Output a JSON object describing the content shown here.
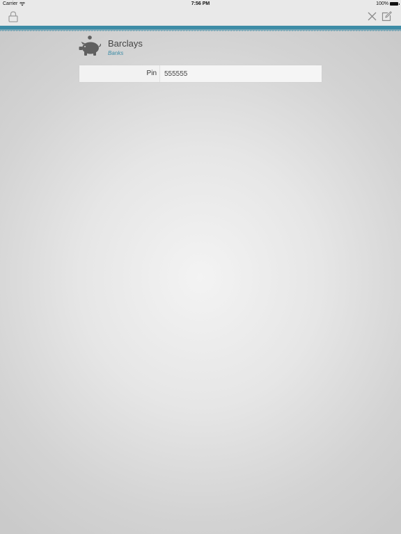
{
  "status_bar": {
    "carrier": "Carrier",
    "time": "7:56 PM",
    "battery": "100%"
  },
  "nav": {
    "left_icon": "lock-icon",
    "right_icons": [
      "close-icon",
      "edit-icon"
    ]
  },
  "item": {
    "icon": "piggy-bank-icon",
    "title": "Barclays",
    "category": "Banks"
  },
  "fields": [
    {
      "label": "Pin",
      "value": "555555"
    }
  ],
  "colors": {
    "accent": "#3d8ca6",
    "bar_background": "#e9e9e9",
    "icon_gray": "#606060"
  }
}
